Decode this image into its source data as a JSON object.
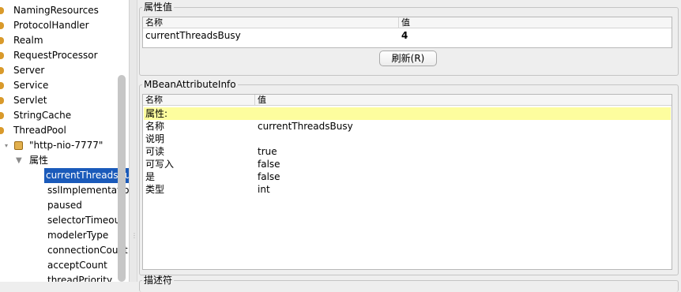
{
  "tree": {
    "top_items": [
      "NamingResources",
      "ProtocolHandler",
      "Realm",
      "RequestProcessor",
      "Server",
      "Service",
      "Servlet",
      "StringCache",
      "ThreadPool"
    ],
    "bean_node": "\"http-nio-7777\"",
    "attributes_node": "属性",
    "attributes": [
      "currentThreadsBusy",
      "sslImplementationName",
      "paused",
      "selectorTimeout",
      "modelerType",
      "connectionCount",
      "acceptCount",
      "threadPriority"
    ],
    "selected_attribute": "currentThreadsBusy"
  },
  "attribute_value": {
    "legend": "属性值",
    "columns": [
      "名称",
      "值"
    ],
    "row": {
      "name": "currentThreadsBusy",
      "value": "4"
    },
    "refresh_label": "刷新(R)"
  },
  "mbean_info": {
    "legend": "MBeanAttributeInfo",
    "columns": [
      "名称",
      "值"
    ],
    "header_row": "属性:",
    "rows": [
      {
        "name": "名称",
        "value": "currentThreadsBusy"
      },
      {
        "name": "说明",
        "value": ""
      },
      {
        "name": "可读",
        "value": "true"
      },
      {
        "name": "可写入",
        "value": "false"
      },
      {
        "name": "是",
        "value": "false"
      },
      {
        "name": "类型",
        "value": "int"
      }
    ]
  },
  "descriptor": {
    "legend": "描述符"
  },
  "colors": {
    "selection": "#1a5aba",
    "highlight_row": "#fdfd9e",
    "folder_bullet": "#d99a2b"
  }
}
